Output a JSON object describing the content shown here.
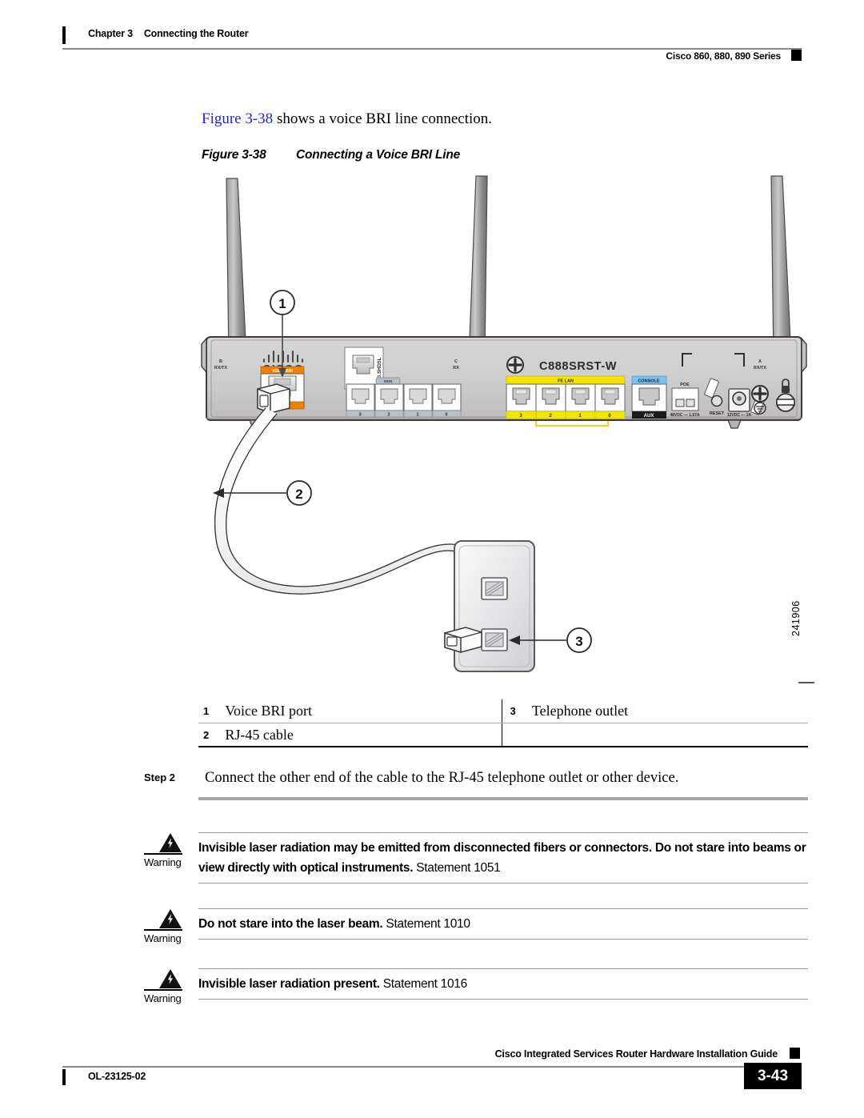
{
  "header": {
    "chapter_num": "Chapter 3",
    "chapter_title": "Connecting the Router",
    "series": "Cisco 860, 880, 890 Series"
  },
  "intro": {
    "link_text": "Figure 3-38",
    "rest_text": " shows a voice BRI line connection."
  },
  "figure": {
    "caption_number": "Figure 3-38",
    "caption_title": "Connecting a Voice BRI Line",
    "figure_id": "241906",
    "router": {
      "model_label": "C888SRST-W",
      "brand": "CISCO",
      "antenna_left_label_line1": "B",
      "antenna_left_label_line2": "RX/TX",
      "antenna_mid_label_line1": "C",
      "antenna_mid_label_line2": "RX",
      "antenna_right_label_line1": "A",
      "antenna_right_label_line2": "RX/TX",
      "voice_bri_label": "VOICE BRI",
      "shdsl_label": "G.SHDSL",
      "isdn_tab_label": "ISDN",
      "isdn_port_numbers": [
        "3",
        "2",
        "1",
        "0"
      ],
      "fe_lan_label": "FE LAN",
      "fe_lan_port_numbers": [
        "3",
        "2",
        "1",
        "0"
      ],
      "console_label": "CONSOLE",
      "aux_label": "AUX",
      "poe_label": "POE",
      "poe_rating": "48VDC 1.67A",
      "reset_label": "RESET",
      "power_rating": "12VDC 2A"
    },
    "callouts": [
      {
        "number": "1"
      },
      {
        "number": "2"
      },
      {
        "number": "3"
      }
    ]
  },
  "legend": {
    "rows": [
      {
        "num_left": "1",
        "text_left": "Voice BRI port",
        "num_right": "3",
        "text_right": "Telephone outlet"
      },
      {
        "num_left": "2",
        "text_left": "RJ-45 cable",
        "num_right": "",
        "text_right": ""
      }
    ]
  },
  "step": {
    "label": "Step 2",
    "text": "Connect the other end of the cable to the RJ-45 telephone outlet or other device."
  },
  "warnings": [
    {
      "label": "Warning",
      "bold_text": "Invisible laser radiation may be emitted from disconnected fibers or connectors. Do not stare into beams or view directly with optical instruments.",
      "statement": " Statement 1051"
    },
    {
      "label": "Warning",
      "bold_text": "Do not stare into the laser beam.",
      "statement": " Statement 1010"
    },
    {
      "label": "Warning",
      "bold_text": "Invisible laser radiation present.",
      "statement": " Statement 1016"
    }
  ],
  "footer": {
    "guide_title": "Cisco Integrated Services Router Hardware Installation Guide",
    "doc_id": "OL-23125-02",
    "page_number": "3-43"
  }
}
